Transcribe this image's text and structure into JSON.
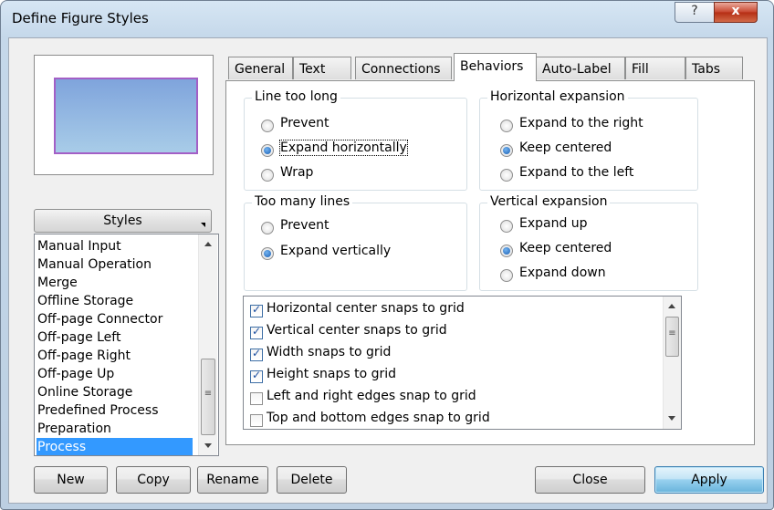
{
  "window": {
    "title": "Define Figure Styles",
    "help_glyph": "?",
    "close_glyph": "x"
  },
  "styles_header": "Styles",
  "style_list": {
    "items": [
      "Manual Input",
      "Manual Operation",
      "Merge",
      "Offline Storage",
      "Off-page Connector",
      "Off-page Left",
      "Off-page Right",
      "Off-page Up",
      "Online Storage",
      "Predefined Process",
      "Preparation",
      "Process"
    ],
    "selected": "Process"
  },
  "tabs": [
    "General",
    "Text",
    "Connections",
    "Behaviors",
    "Auto-Label",
    "Fill",
    "Tabs"
  ],
  "active_tab": "Behaviors",
  "groups": {
    "line_too_long": {
      "label": "Line too long",
      "options": [
        "Prevent",
        "Expand horizontally",
        "Wrap"
      ],
      "selected": "Expand horizontally"
    },
    "horizontal_expansion": {
      "label": "Horizontal expansion",
      "options": [
        "Expand to the right",
        "Keep centered",
        "Expand to the left"
      ],
      "selected": "Keep centered"
    },
    "too_many_lines": {
      "label": "Too many lines",
      "options": [
        "Prevent",
        "Expand vertically"
      ],
      "selected": "Expand vertically"
    },
    "vertical_expansion": {
      "label": "Vertical expansion",
      "options": [
        "Expand up",
        "Keep centered",
        "Expand down"
      ],
      "selected": "Keep centered"
    }
  },
  "checklist": [
    {
      "label": "Horizontal center snaps to grid",
      "checked": true
    },
    {
      "label": "Vertical center snaps to grid",
      "checked": true
    },
    {
      "label": "Width snaps to grid",
      "checked": true
    },
    {
      "label": "Height snaps to grid",
      "checked": true
    },
    {
      "label": "Left and right edges snap to grid",
      "checked": false
    },
    {
      "label": "Top and bottom edges snap to grid",
      "checked": false
    }
  ],
  "buttons": {
    "new": "New",
    "copy": "Copy",
    "rename": "Rename",
    "delete": "Delete",
    "close": "Close",
    "apply": "Apply"
  },
  "colors": {
    "selection": "#3399ff",
    "preview_border": "#a35fc6",
    "close_button": "#c7452d"
  },
  "icons": {
    "help": "question-mark-icon",
    "close": "close-icon",
    "dropdown": "dropdown-arrow-icon",
    "scroll_up": "scroll-up-arrow-icon",
    "scroll_down": "scroll-down-arrow-icon"
  }
}
